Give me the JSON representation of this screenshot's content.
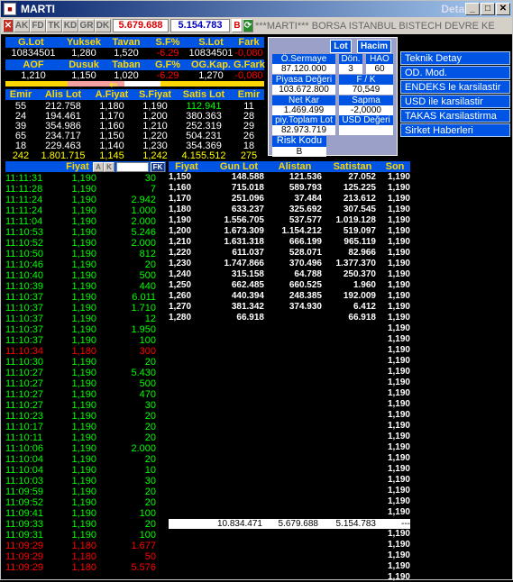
{
  "window": {
    "title": "MARTI",
    "title_right": "Detay"
  },
  "toolbar": {
    "tabs": [
      "AK",
      "FD",
      "TK",
      "KD",
      "GR",
      "DK"
    ],
    "price1": "5.679.688",
    "price2": "5.154.783",
    "b_label": "B",
    "ticker": "***MARTI*** BORSA ISTANBUL BISTECH DEVRE KE"
  },
  "summary": {
    "row1_headers": [
      "G.Lot",
      "Yuksek",
      "Tavan",
      "S.F%",
      "S.Lot",
      "Fark"
    ],
    "row1_values": [
      "10834501",
      "1,280",
      "1,520",
      "-6.29",
      "10834501",
      "-0,080"
    ],
    "row2_headers": [
      "AOF",
      "Dusuk",
      "Taban",
      "G.F%",
      "OG.Kap.",
      "G.Fark"
    ],
    "row2_values": [
      "1,210",
      "1,150",
      "1,020",
      "-6.29",
      "1,270",
      "-0,080"
    ]
  },
  "depth": {
    "headers": [
      "Emir",
      "Alis Lot",
      "A.Fiyat",
      "S.Fiyat",
      "Satis Lot",
      "Emir"
    ],
    "rows": [
      [
        "55",
        "212.758",
        "1,180",
        "1,190",
        "112.941",
        "11"
      ],
      [
        "24",
        "194.461",
        "1,170",
        "1,200",
        "380.363",
        "28"
      ],
      [
        "39",
        "354.986",
        "1,160",
        "1,210",
        "252.319",
        "29"
      ],
      [
        "65",
        "234.717",
        "1,150",
        "1,220",
        "504.231",
        "26"
      ],
      [
        "18",
        "229.463",
        "1,140",
        "1,230",
        "354.369",
        "18"
      ]
    ],
    "total": [
      "242",
      "1.801.715",
      "1,145",
      "1,242",
      "4.155.512",
      "275"
    ]
  },
  "panel": {
    "tabs": [
      "Lot",
      "Hacim"
    ],
    "osermaye_label": "Ö.Sermaye",
    "osermaye": "87.120.000",
    "don_label": "Dön.",
    "don": "3",
    "hao_label": "HAO",
    "hao": "60",
    "piyasa_label": "Piyasa Değeri",
    "piyasa": "103.672.800",
    "fk_label": "F / K",
    "fk": "70,549",
    "netkar_label": "Net Kar",
    "netkar": "1.469.499",
    "sapma_label": "Sapma",
    "sapma": "-2,0000",
    "piytop_label": "piy.Toplam Lot",
    "piytop": "82.973.719",
    "usd_label": "USD Değeri",
    "usd": "",
    "risk_label": "Risk Kodu",
    "risk": "B"
  },
  "menu": [
    "Teknik Detay",
    "OD. Mod.",
    "ENDEKS le karsilastir",
    "USD ile karsilastir",
    "TAKAS Karsilastirma",
    "Sirket Haberleri"
  ],
  "trades": {
    "fiyat_label": "Fiyat",
    "a_label": "A",
    "k_label": "K",
    "fk_label": "FK",
    "rows": [
      [
        "11:11:31",
        "1,190",
        "30",
        "g"
      ],
      [
        "11:11:28",
        "1,190",
        "7",
        "g"
      ],
      [
        "11:11:24",
        "1,190",
        "2.942",
        "g"
      ],
      [
        "11:11:24",
        "1,190",
        "1.000",
        "g"
      ],
      [
        "11:11:04",
        "1,190",
        "2.000",
        "g"
      ],
      [
        "11:10:53",
        "1,190",
        "5.246",
        "g"
      ],
      [
        "11:10:52",
        "1,190",
        "2.000",
        "g"
      ],
      [
        "11:10:50",
        "1,190",
        "812",
        "g"
      ],
      [
        "11:10:46",
        "1,190",
        "20",
        "g"
      ],
      [
        "11:10:40",
        "1,190",
        "500",
        "g"
      ],
      [
        "11:10:39",
        "1,190",
        "440",
        "g"
      ],
      [
        "11:10:37",
        "1,190",
        "6.011",
        "g"
      ],
      [
        "11:10:37",
        "1,190",
        "1.710",
        "g"
      ],
      [
        "11:10:37",
        "1,190",
        "12",
        "g"
      ],
      [
        "11:10:37",
        "1,190",
        "1.950",
        "g"
      ],
      [
        "11:10:37",
        "1,190",
        "100",
        "g"
      ],
      [
        "11:10:34",
        "1,180",
        "300",
        "r"
      ],
      [
        "11:10:30",
        "1,190",
        "20",
        "g"
      ],
      [
        "11:10:27",
        "1,190",
        "5.430",
        "g"
      ],
      [
        "11:10:27",
        "1,190",
        "500",
        "g"
      ],
      [
        "11:10:27",
        "1,190",
        "470",
        "g"
      ],
      [
        "11:10:27",
        "1,190",
        "30",
        "g"
      ],
      [
        "11:10:23",
        "1,190",
        "20",
        "g"
      ],
      [
        "11:10:17",
        "1,190",
        "20",
        "g"
      ],
      [
        "11:10:11",
        "1,190",
        "20",
        "g"
      ],
      [
        "11:10:06",
        "1,190",
        "2.000",
        "g"
      ],
      [
        "11:10:04",
        "1,190",
        "20",
        "g"
      ],
      [
        "11:10:04",
        "1,190",
        "10",
        "g"
      ],
      [
        "11:10:03",
        "1,190",
        "30",
        "g"
      ],
      [
        "11:09:59",
        "1,190",
        "20",
        "g"
      ],
      [
        "11:09:52",
        "1,190",
        "20",
        "g"
      ],
      [
        "11:09:41",
        "1,190",
        "100",
        "g"
      ],
      [
        "11:09:33",
        "1,190",
        "20",
        "g"
      ],
      [
        "11:09:31",
        "1,190",
        "100",
        "g"
      ],
      [
        "11:09:29",
        "1,180",
        "1.677",
        "r"
      ],
      [
        "11:09:29",
        "1,180",
        "50",
        "r"
      ],
      [
        "11:09:29",
        "1,180",
        "5.576",
        "r"
      ]
    ]
  },
  "volume": {
    "headers": [
      "Fiyat",
      "Gun Lot",
      "Alistan",
      "Satistan",
      "Son"
    ],
    "rows": [
      [
        "1,150",
        "148.588",
        "121.536",
        "27.052",
        "1,190"
      ],
      [
        "1,160",
        "715.018",
        "589.793",
        "125.225",
        "1,190"
      ],
      [
        "1,170",
        "251.096",
        "37.484",
        "213.612",
        "1,190"
      ],
      [
        "1,180",
        "633.237",
        "325.692",
        "307.545",
        "1,190"
      ],
      [
        "1,190",
        "1.556.705",
        "537.577",
        "1.019.128",
        "1,190"
      ],
      [
        "1,200",
        "1.673.309",
        "1.154.212",
        "519.097",
        "1,190"
      ],
      [
        "1,210",
        "1.631.318",
        "666.199",
        "965.119",
        "1,190"
      ],
      [
        "1,220",
        "611.037",
        "528.071",
        "82.966",
        "1,190"
      ],
      [
        "1,230",
        "1.747.866",
        "370.496",
        "1.377.370",
        "1,190"
      ],
      [
        "1,240",
        "315.158",
        "64.788",
        "250.370",
        "1,190"
      ],
      [
        "1,250",
        "662.485",
        "660.525",
        "1.960",
        "1,190"
      ],
      [
        "1,260",
        "440.394",
        "248.385",
        "192.009",
        "1,190"
      ],
      [
        "1,270",
        "381.342",
        "374.930",
        "6.412",
        "1,190"
      ],
      [
        "1,280",
        "66.918",
        "",
        "66.918",
        "1,190"
      ]
    ],
    "son_extra_count": 24,
    "son_value": "1,190",
    "total": [
      "10.834.471",
      "5.679.688",
      "5.154.783",
      "---"
    ]
  }
}
